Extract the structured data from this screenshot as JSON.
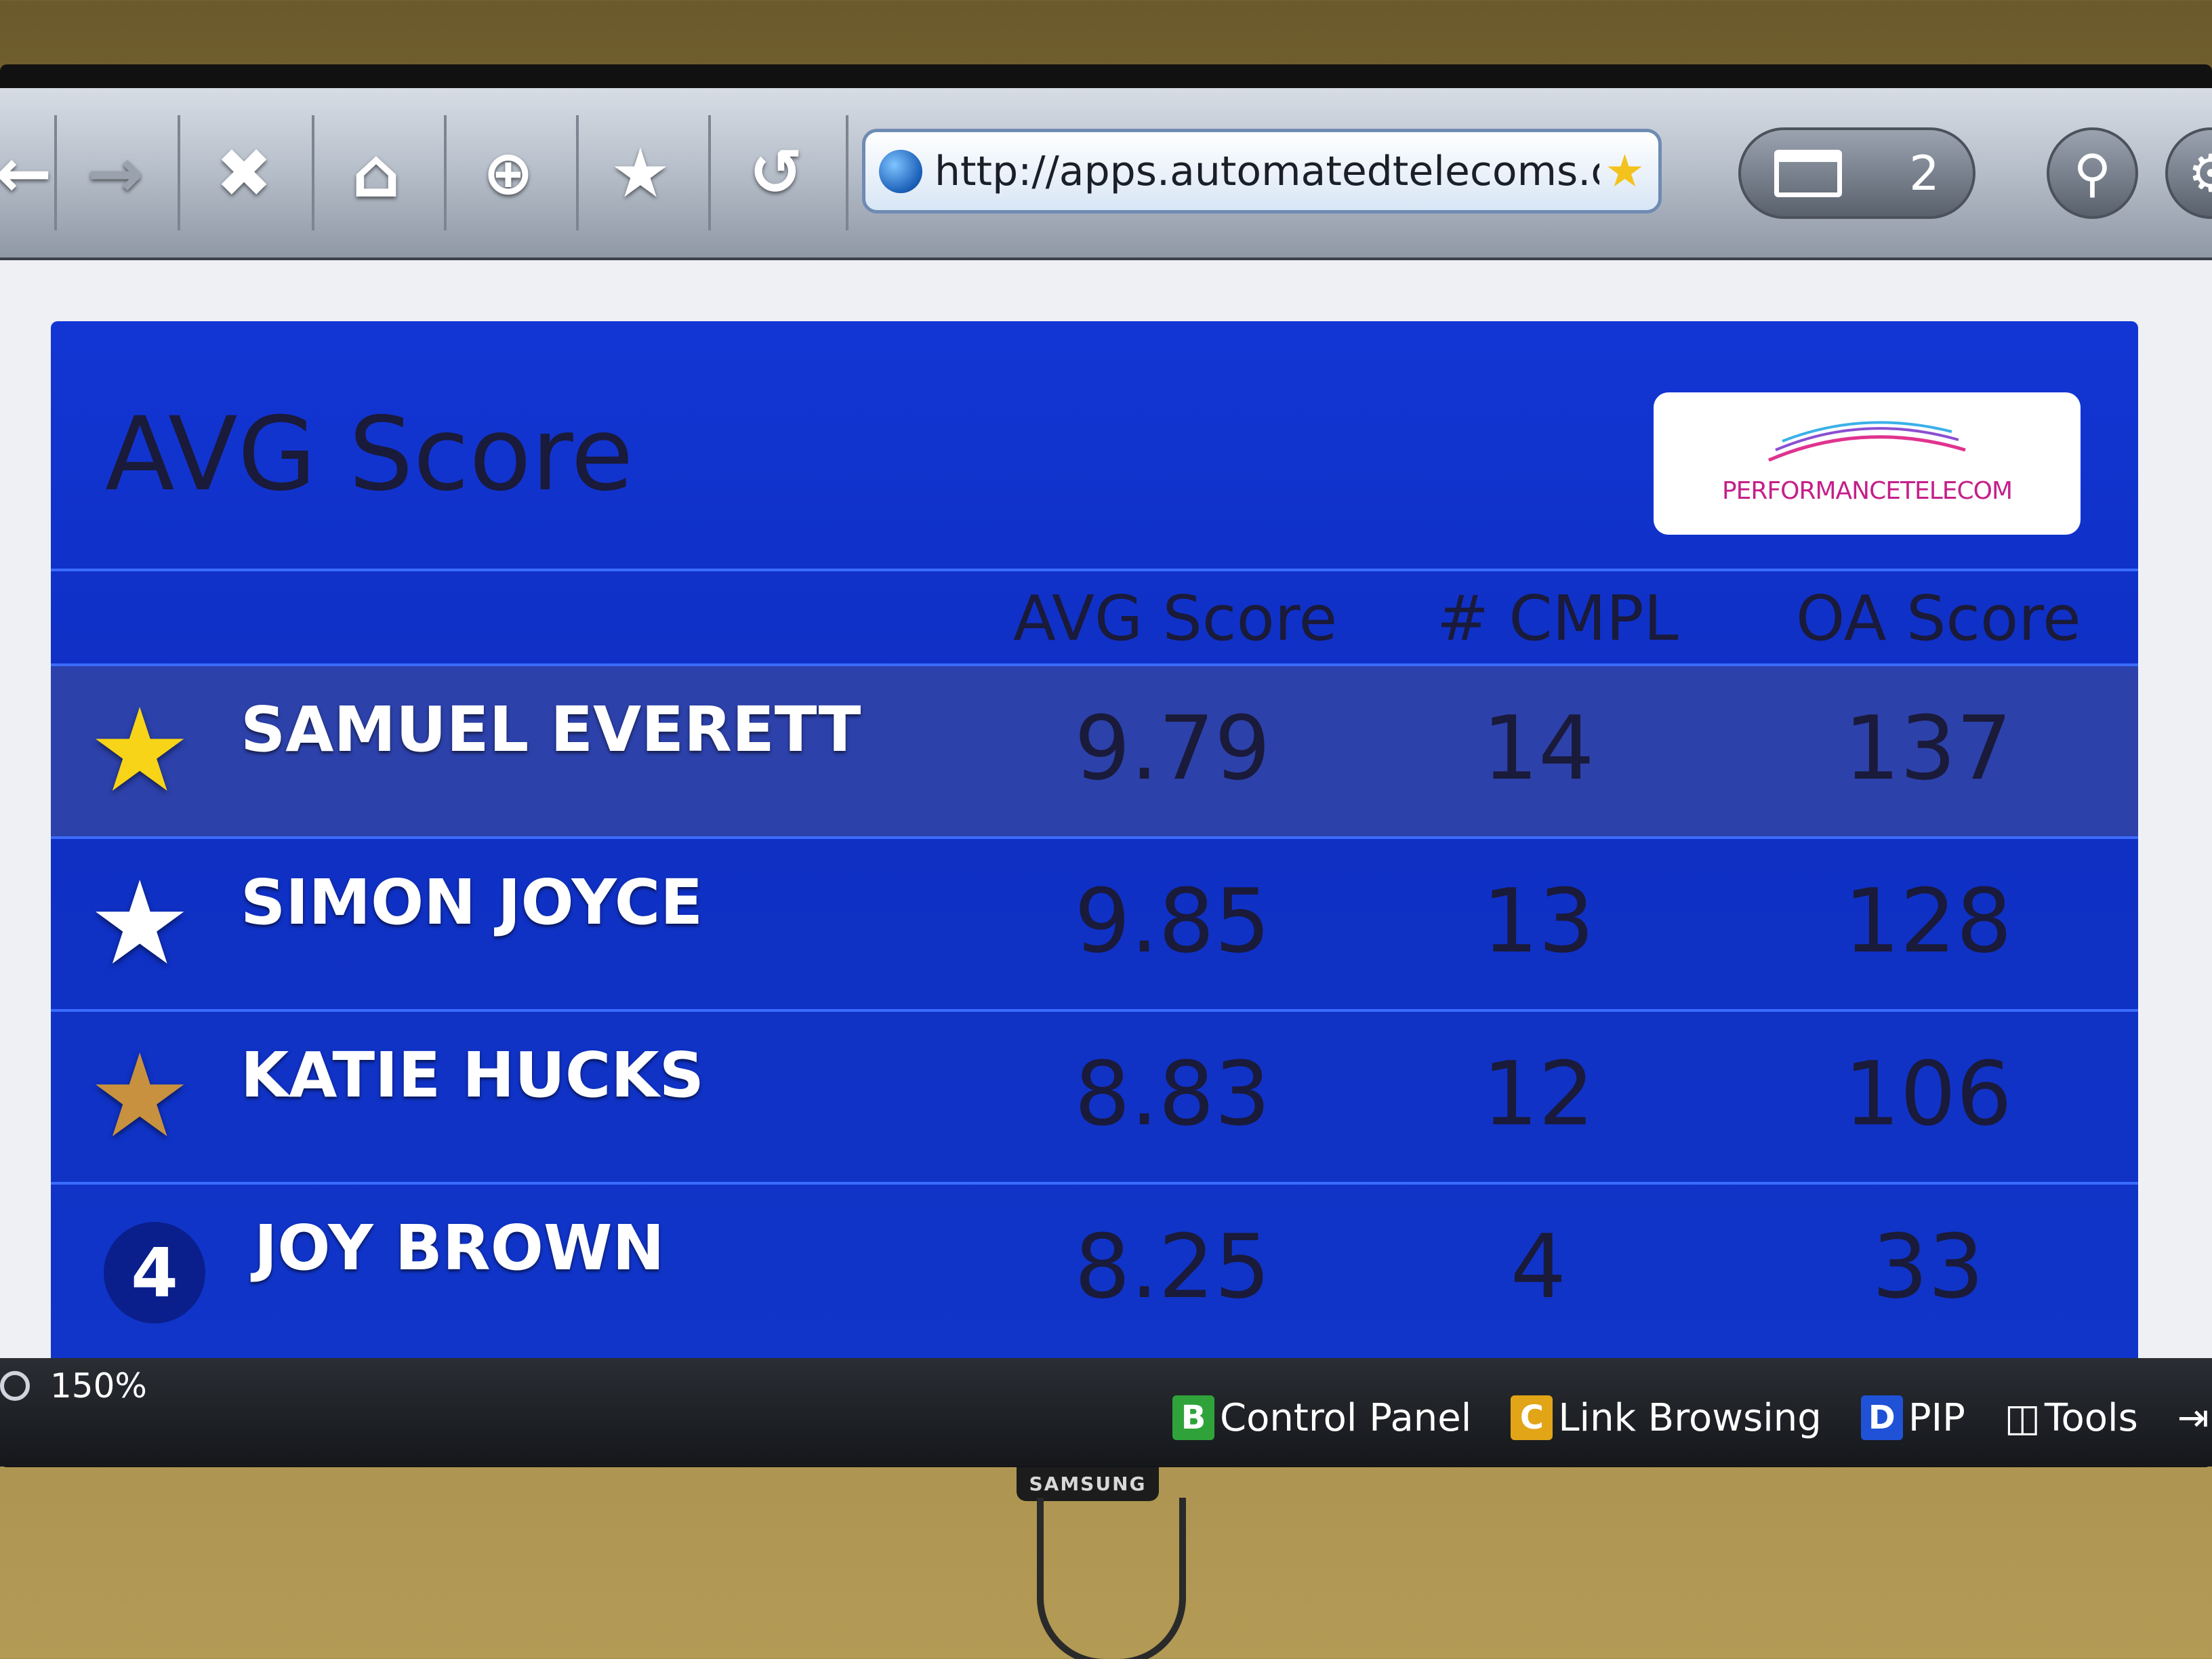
{
  "browser": {
    "url": "http://apps.automatedtelecoms.com...",
    "tab_count": "2",
    "zoom": "150%"
  },
  "board": {
    "title": "AVG Score",
    "logo_text": "PERFORMANCETELECOM",
    "columns": [
      "AVG Score",
      "# CMPL",
      "OA Score"
    ],
    "rows": [
      {
        "rank": "",
        "star": "gold",
        "name": "SAMUEL EVERETT",
        "avg": "9.79",
        "cmpl": "14",
        "oa": "137"
      },
      {
        "rank": "",
        "star": "silver",
        "name": "SIMON JOYCE",
        "avg": "9.85",
        "cmpl": "13",
        "oa": "128"
      },
      {
        "rank": "",
        "star": "bronze",
        "name": "KATIE HUCKS",
        "avg": "8.83",
        "cmpl": "12",
        "oa": "106"
      },
      {
        "rank": "4",
        "star": "",
        "name": "JOY BROWN",
        "avg": "8.25",
        "cmpl": "4",
        "oa": "33"
      }
    ],
    "colors": {
      "gold": "#f7d417",
      "silver": "#ffffff",
      "bronze": "#c8913f"
    }
  },
  "hints": {
    "b_key": "B",
    "b_label": "Control Panel",
    "c_key": "C",
    "c_label": "Link Browsing",
    "d_key": "D",
    "d_label": "PIP",
    "tools_label": "Tools"
  },
  "tv_brand": "SAMSUNG"
}
